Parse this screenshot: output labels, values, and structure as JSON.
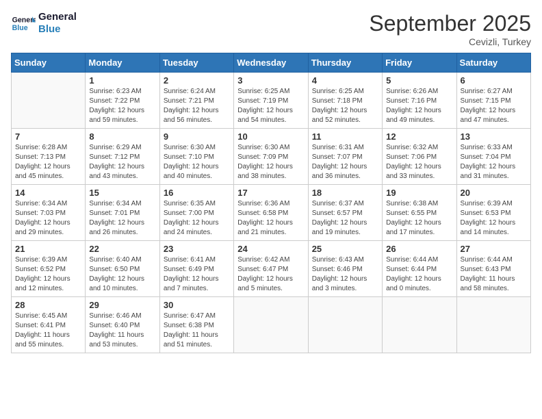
{
  "header": {
    "logo_line1": "General",
    "logo_line2": "Blue",
    "month_title": "September 2025",
    "location": "Cevizli, Turkey"
  },
  "days_of_week": [
    "Sunday",
    "Monday",
    "Tuesday",
    "Wednesday",
    "Thursday",
    "Friday",
    "Saturday"
  ],
  "weeks": [
    [
      {
        "day": "",
        "info": ""
      },
      {
        "day": "1",
        "info": "Sunrise: 6:23 AM\nSunset: 7:22 PM\nDaylight: 12 hours\nand 59 minutes."
      },
      {
        "day": "2",
        "info": "Sunrise: 6:24 AM\nSunset: 7:21 PM\nDaylight: 12 hours\nand 56 minutes."
      },
      {
        "day": "3",
        "info": "Sunrise: 6:25 AM\nSunset: 7:19 PM\nDaylight: 12 hours\nand 54 minutes."
      },
      {
        "day": "4",
        "info": "Sunrise: 6:25 AM\nSunset: 7:18 PM\nDaylight: 12 hours\nand 52 minutes."
      },
      {
        "day": "5",
        "info": "Sunrise: 6:26 AM\nSunset: 7:16 PM\nDaylight: 12 hours\nand 49 minutes."
      },
      {
        "day": "6",
        "info": "Sunrise: 6:27 AM\nSunset: 7:15 PM\nDaylight: 12 hours\nand 47 minutes."
      }
    ],
    [
      {
        "day": "7",
        "info": "Sunrise: 6:28 AM\nSunset: 7:13 PM\nDaylight: 12 hours\nand 45 minutes."
      },
      {
        "day": "8",
        "info": "Sunrise: 6:29 AM\nSunset: 7:12 PM\nDaylight: 12 hours\nand 43 minutes."
      },
      {
        "day": "9",
        "info": "Sunrise: 6:30 AM\nSunset: 7:10 PM\nDaylight: 12 hours\nand 40 minutes."
      },
      {
        "day": "10",
        "info": "Sunrise: 6:30 AM\nSunset: 7:09 PM\nDaylight: 12 hours\nand 38 minutes."
      },
      {
        "day": "11",
        "info": "Sunrise: 6:31 AM\nSunset: 7:07 PM\nDaylight: 12 hours\nand 36 minutes."
      },
      {
        "day": "12",
        "info": "Sunrise: 6:32 AM\nSunset: 7:06 PM\nDaylight: 12 hours\nand 33 minutes."
      },
      {
        "day": "13",
        "info": "Sunrise: 6:33 AM\nSunset: 7:04 PM\nDaylight: 12 hours\nand 31 minutes."
      }
    ],
    [
      {
        "day": "14",
        "info": "Sunrise: 6:34 AM\nSunset: 7:03 PM\nDaylight: 12 hours\nand 29 minutes."
      },
      {
        "day": "15",
        "info": "Sunrise: 6:34 AM\nSunset: 7:01 PM\nDaylight: 12 hours\nand 26 minutes."
      },
      {
        "day": "16",
        "info": "Sunrise: 6:35 AM\nSunset: 7:00 PM\nDaylight: 12 hours\nand 24 minutes."
      },
      {
        "day": "17",
        "info": "Sunrise: 6:36 AM\nSunset: 6:58 PM\nDaylight: 12 hours\nand 21 minutes."
      },
      {
        "day": "18",
        "info": "Sunrise: 6:37 AM\nSunset: 6:57 PM\nDaylight: 12 hours\nand 19 minutes."
      },
      {
        "day": "19",
        "info": "Sunrise: 6:38 AM\nSunset: 6:55 PM\nDaylight: 12 hours\nand 17 minutes."
      },
      {
        "day": "20",
        "info": "Sunrise: 6:39 AM\nSunset: 6:53 PM\nDaylight: 12 hours\nand 14 minutes."
      }
    ],
    [
      {
        "day": "21",
        "info": "Sunrise: 6:39 AM\nSunset: 6:52 PM\nDaylight: 12 hours\nand 12 minutes."
      },
      {
        "day": "22",
        "info": "Sunrise: 6:40 AM\nSunset: 6:50 PM\nDaylight: 12 hours\nand 10 minutes."
      },
      {
        "day": "23",
        "info": "Sunrise: 6:41 AM\nSunset: 6:49 PM\nDaylight: 12 hours\nand 7 minutes."
      },
      {
        "day": "24",
        "info": "Sunrise: 6:42 AM\nSunset: 6:47 PM\nDaylight: 12 hours\nand 5 minutes."
      },
      {
        "day": "25",
        "info": "Sunrise: 6:43 AM\nSunset: 6:46 PM\nDaylight: 12 hours\nand 3 minutes."
      },
      {
        "day": "26",
        "info": "Sunrise: 6:44 AM\nSunset: 6:44 PM\nDaylight: 12 hours\nand 0 minutes."
      },
      {
        "day": "27",
        "info": "Sunrise: 6:44 AM\nSunset: 6:43 PM\nDaylight: 11 hours\nand 58 minutes."
      }
    ],
    [
      {
        "day": "28",
        "info": "Sunrise: 6:45 AM\nSunset: 6:41 PM\nDaylight: 11 hours\nand 55 minutes."
      },
      {
        "day": "29",
        "info": "Sunrise: 6:46 AM\nSunset: 6:40 PM\nDaylight: 11 hours\nand 53 minutes."
      },
      {
        "day": "30",
        "info": "Sunrise: 6:47 AM\nSunset: 6:38 PM\nDaylight: 11 hours\nand 51 minutes."
      },
      {
        "day": "",
        "info": ""
      },
      {
        "day": "",
        "info": ""
      },
      {
        "day": "",
        "info": ""
      },
      {
        "day": "",
        "info": ""
      }
    ]
  ]
}
